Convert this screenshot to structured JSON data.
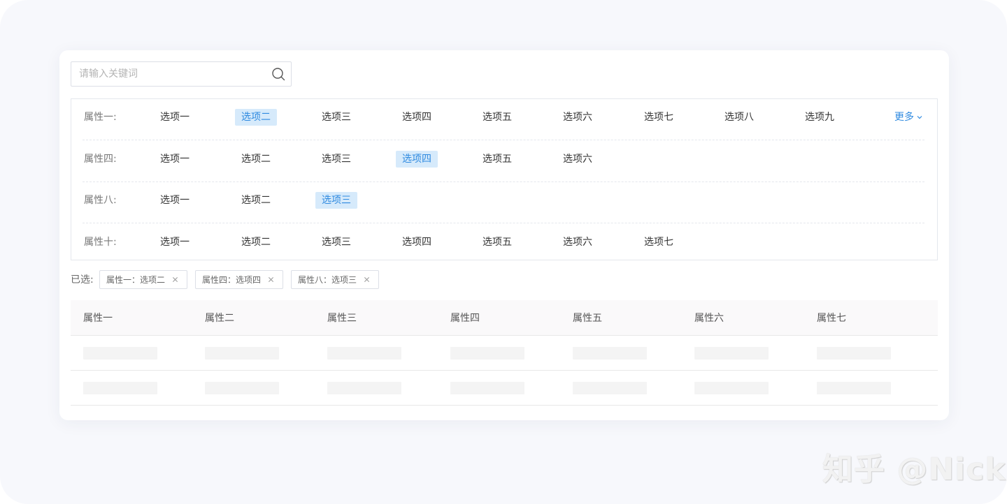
{
  "search": {
    "placeholder": "请输入关键词",
    "value": ""
  },
  "filters": [
    {
      "attr": "属性一:",
      "options": [
        "选项一",
        "选项二",
        "选项三",
        "选项四",
        "选项五",
        "选项六",
        "选项七",
        "选项八",
        "选项九"
      ],
      "selected": 1,
      "more_label": "更多"
    },
    {
      "attr": "属性四:",
      "options": [
        "选项一",
        "选项二",
        "选项三",
        "选项四",
        "选项五",
        "选项六"
      ],
      "selected": 3
    },
    {
      "attr": "属性八:",
      "options": [
        "选项一",
        "选项二",
        "选项三"
      ],
      "selected": 2
    },
    {
      "attr": "属性十:",
      "options": [
        "选项一",
        "选项二",
        "选项三",
        "选项四",
        "选项五",
        "选项六",
        "选项七"
      ],
      "selected": -1
    }
  ],
  "selected_tags": {
    "label": "已选:",
    "tags": [
      "属性一：选项二",
      "属性四：选项四",
      "属性八：选项三"
    ]
  },
  "table": {
    "headers": [
      "属性一",
      "属性二",
      "属性三",
      "属性四",
      "属性五",
      "属性六",
      "属性七"
    ],
    "row_count": 2
  },
  "colors": {
    "accent": "#2f8ae0",
    "selected_bg": "#d6eafb"
  },
  "watermark": "知乎 @Nick"
}
